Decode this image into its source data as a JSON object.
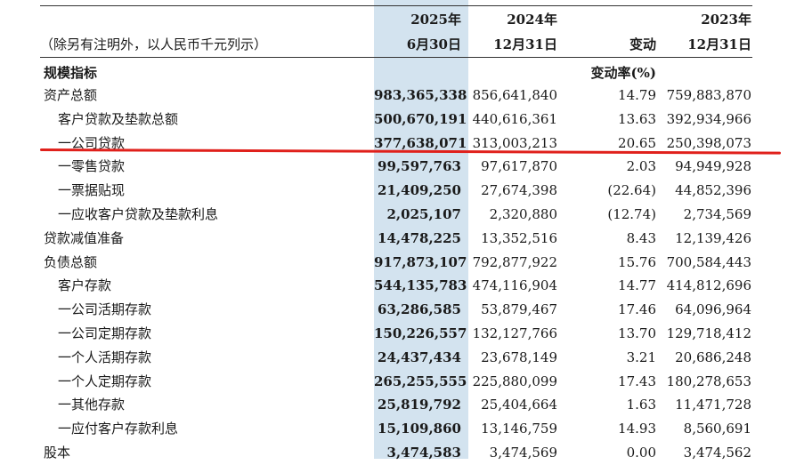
{
  "header": {
    "note": "（除另有注明外，以人民币千元列示）",
    "col_2025_year": "2025年",
    "col_2025_date": "6月30日",
    "col_2024_year": "2024年",
    "col_2024_date": "12月31日",
    "col_change": "变动",
    "col_2023_year": "2023年",
    "col_2023_date": "12月31日",
    "change_rate_label": "变动率(%)"
  },
  "section_title": "规模指标",
  "rows": [
    {
      "label": "资产总额",
      "indent": 0,
      "v2025": "983,365,338",
      "v2024": "856,641,840",
      "change": "14.79",
      "v2023": "759,883,870"
    },
    {
      "label": "客户贷款及垫款总额",
      "indent": 1,
      "v2025": "500,670,191",
      "v2024": "440,616,361",
      "change": "13.63",
      "v2023": "392,934,966"
    },
    {
      "label": "一公司贷款",
      "indent": 1,
      "v2025": "377,638,071",
      "v2024": "313,003,213",
      "change": "20.65",
      "v2023": "250,398,073"
    },
    {
      "label": "一零售贷款",
      "indent": 1,
      "v2025": "99,597,763",
      "v2024": "97,617,870",
      "change": "2.03",
      "v2023": "94,949,928"
    },
    {
      "label": "一票据贴现",
      "indent": 1,
      "v2025": "21,409,250",
      "v2024": "27,674,398",
      "change": "(22.64)",
      "v2023": "44,852,396"
    },
    {
      "label": "一应收客户贷款及垫款利息",
      "indent": 1,
      "v2025": "2,025,107",
      "v2024": "2,320,880",
      "change": "(12.74)",
      "v2023": "2,734,569"
    },
    {
      "label": "贷款减值准备",
      "indent": 0,
      "v2025": "14,478,225",
      "v2024": "13,352,516",
      "change": "8.43",
      "v2023": "12,139,426"
    },
    {
      "label": "负债总额",
      "indent": 0,
      "v2025": "917,873,107",
      "v2024": "792,877,922",
      "change": "15.76",
      "v2023": "700,584,443"
    },
    {
      "label": "客户存款",
      "indent": 1,
      "v2025": "544,135,783",
      "v2024": "474,116,904",
      "change": "14.77",
      "v2023": "414,812,696"
    },
    {
      "label": "一公司活期存款",
      "indent": 1,
      "v2025": "63,286,585",
      "v2024": "53,879,467",
      "change": "17.46",
      "v2023": "64,096,964"
    },
    {
      "label": "一公司定期存款",
      "indent": 1,
      "v2025": "150,226,557",
      "v2024": "132,127,766",
      "change": "13.70",
      "v2023": "129,718,412"
    },
    {
      "label": "一个人活期存款",
      "indent": 1,
      "v2025": "24,437,434",
      "v2024": "23,678,149",
      "change": "3.21",
      "v2023": "20,686,248"
    },
    {
      "label": "一个人定期存款",
      "indent": 1,
      "v2025": "265,255,555",
      "v2024": "225,880,099",
      "change": "17.43",
      "v2023": "180,278,653"
    },
    {
      "label": "一其他存款",
      "indent": 1,
      "v2025": "25,819,792",
      "v2024": "25,404,664",
      "change": "1.63",
      "v2023": "11,471,728"
    },
    {
      "label": "一应付客户存款利息",
      "indent": 1,
      "v2025": "15,109,860",
      "v2024": "13,146,759",
      "change": "14.93",
      "v2023": "8,560,691"
    },
    {
      "label": "股本",
      "indent": 0,
      "v2025": "3,474,583",
      "v2024": "3,474,569",
      "change": "0.00",
      "v2023": "3,474,562"
    }
  ]
}
